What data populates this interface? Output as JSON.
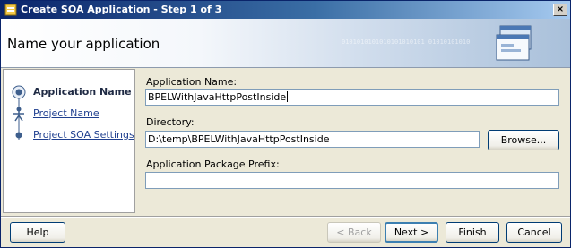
{
  "window": {
    "title": "Create SOA Application - Step 1 of 3",
    "close_label": "×"
  },
  "header": {
    "title": "Name your application",
    "binary_text": "0101010101010101010101 01010101010"
  },
  "steps": [
    {
      "label": "Application Name",
      "state": "current"
    },
    {
      "label": "Project Name",
      "state": "link"
    },
    {
      "label": "Project SOA Settings",
      "state": "link"
    }
  ],
  "form": {
    "app_name_label": "Application Name:",
    "app_name_value": "BPELWithJavaHttpPostInside",
    "directory_label": "Directory:",
    "directory_value": "D:\\temp\\BPELWithJavaHttpPostInside",
    "browse_label": "Browse...",
    "prefix_label": "Application Package Prefix:",
    "prefix_value": ""
  },
  "footer": {
    "help_label": "Help",
    "back_label": "< Back",
    "next_label": "Next >",
    "finish_label": "Finish",
    "cancel_label": "Cancel"
  },
  "colors": {
    "title_bar": "#0a246a",
    "current_step": "#1f2a44",
    "link": "#1f3f8f"
  }
}
